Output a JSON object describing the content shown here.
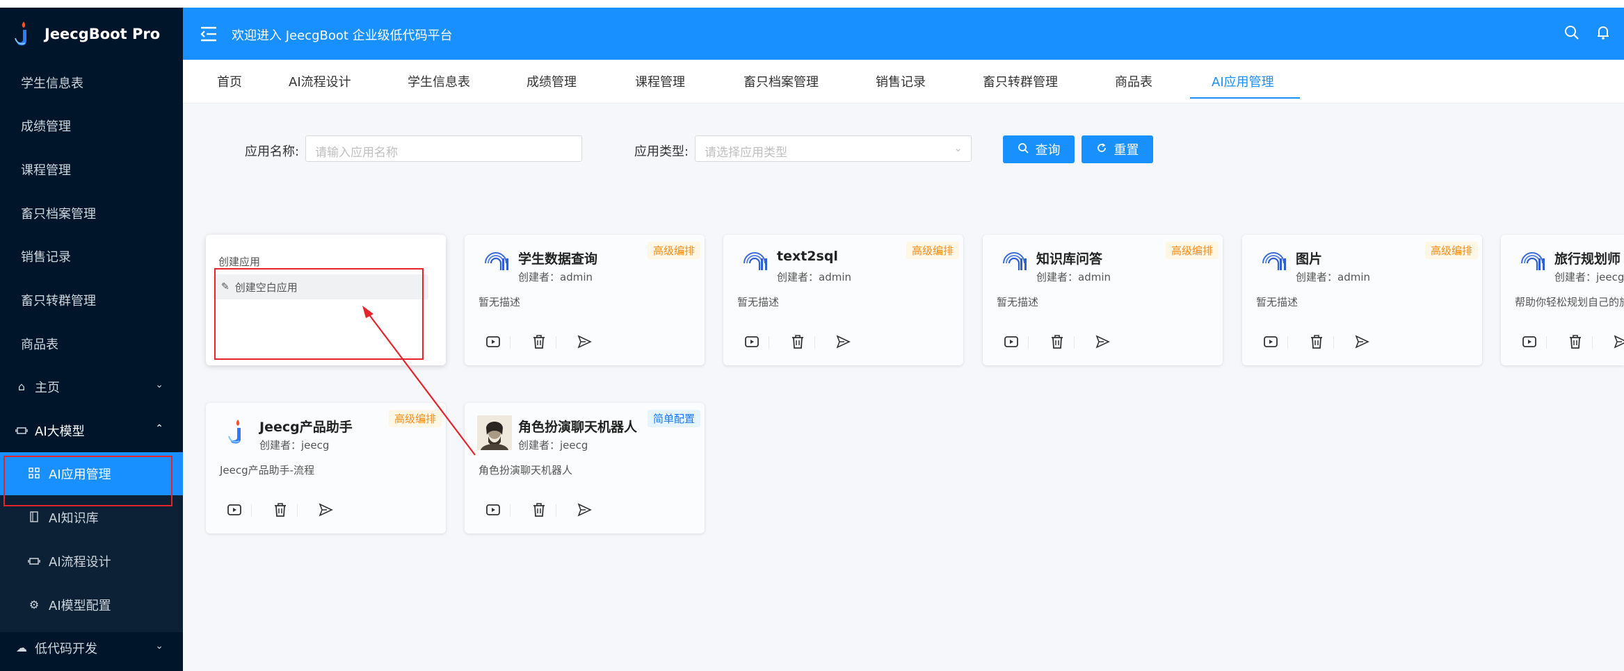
{
  "brand": {
    "name": "JeecgBoot Pro"
  },
  "header": {
    "welcome": "欢迎进入 JeecgBoot 企业级低代码平台"
  },
  "sidebar": {
    "items": [
      {
        "label": "学生信息表"
      },
      {
        "label": "成绩管理"
      },
      {
        "label": "课程管理"
      },
      {
        "label": "畜只档案管理"
      },
      {
        "label": "销售记录"
      },
      {
        "label": "畜只转群管理"
      },
      {
        "label": "商品表"
      },
      {
        "label": "主页"
      },
      {
        "label": "AI大模型"
      },
      {
        "label": "AI应用管理"
      },
      {
        "label": "AI知识库"
      },
      {
        "label": "AI流程设计"
      },
      {
        "label": "AI模型配置"
      },
      {
        "label": "低代码开发"
      }
    ]
  },
  "tabs": [
    "首页",
    "AI流程设计",
    "学生信息表",
    "成绩管理",
    "课程管理",
    "畜只档案管理",
    "销售记录",
    "畜只转群管理",
    "商品表",
    "AI应用管理"
  ],
  "search": {
    "name_label": "应用名称:",
    "name_placeholder": "请输入应用名称",
    "type_label": "应用类型:",
    "type_placeholder": "请选择应用类型",
    "query_label": "查询",
    "reset_label": "重置"
  },
  "create_card": {
    "title": "创建应用",
    "item": "创建空白应用"
  },
  "cards": [
    {
      "title": "学生数据查询",
      "creator": "创建者：admin",
      "desc": "暂无描述",
      "badge": "高级编排"
    },
    {
      "title": "text2sql",
      "creator": "创建者：admin",
      "desc": "暂无描述",
      "badge": "高级编排"
    },
    {
      "title": "知识库问答",
      "creator": "创建者：admin",
      "desc": "暂无描述",
      "badge": "高级编排"
    },
    {
      "title": "图片",
      "creator": "创建者：admin",
      "desc": "暂无描述",
      "badge": "高级编排"
    },
    {
      "title": "旅行规划师",
      "creator": "创建者：jeecg",
      "desc": "帮助你轻松规划自己的旅",
      "badge": ""
    },
    {
      "title": "Jeecg产品助手",
      "creator": "创建者：jeecg",
      "desc": "Jeecg产品助手-流程",
      "badge": "高级编排"
    },
    {
      "title": "角色扮演聊天机器人",
      "creator": "创建者：jeecg",
      "desc": "角色扮演聊天机器人",
      "badge": "简单配置"
    }
  ],
  "colors": {
    "primary": "#1890ff",
    "sidebar_bg": "#001529",
    "annotation_red": "#e5242b",
    "badge_adv": "#fa8c16",
    "badge_simple": "#1677ff"
  }
}
